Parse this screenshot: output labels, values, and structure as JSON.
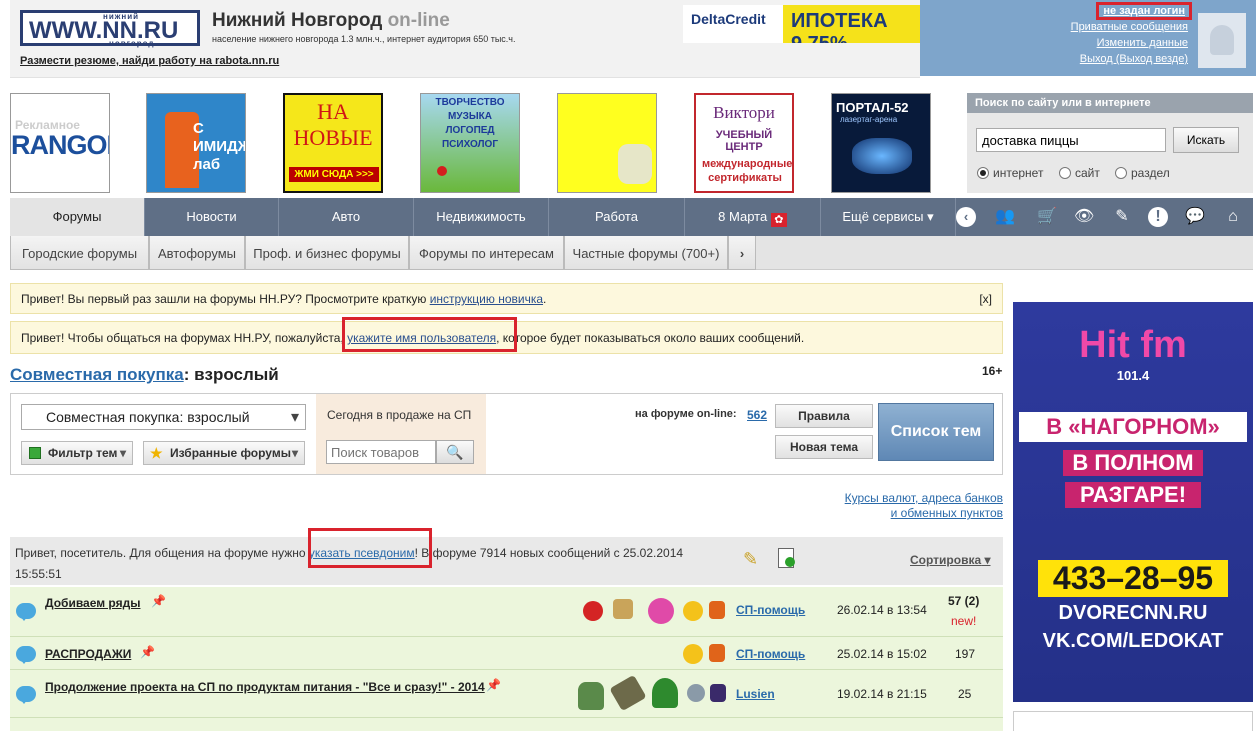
{
  "header": {
    "logo_top": "нижний",
    "logo_main": "WWW.NN.RU",
    "logo_bottom": "новгород",
    "title": "Нижний Новгород",
    "title_suffix": "on-line",
    "subtitle": "население нижнего новгорода 1.3 млн.ч., интернет аудитория 650 тыс.ч.",
    "resume_link": "Размести резюме, найди работу на rabota.nn.ru",
    "delta_logo": "DeltaCredit",
    "delta_text": "ИПОТЕКА 9,75%"
  },
  "user": {
    "login_status": "не задан логин",
    "links": [
      "Приватные сообщения",
      "Изменить данные",
      "Выход (Выход везде)"
    ]
  },
  "ads": {
    "rangon": "RANGON",
    "imidj": "С ИМИДЖ лаб",
    "novye": "НА НОВЫЕ",
    "novye_sub": "ЖМИ СЮДА >>>",
    "tvorch": [
      "ТВОРЧЕСТВО",
      "МУЗЫКА",
      "ЛОГОПЕД",
      "ПСИХОЛОГ"
    ],
    "viktori": [
      "Виктори",
      "УЧЕБНЫЙ ЦЕНТР",
      "международные сертификаты"
    ],
    "portal": "ПОРТАЛ-52",
    "portal_sub": "лазертаг-арена"
  },
  "search": {
    "title": "Поиск по сайту или в интернете",
    "value": "доставка пиццы",
    "button": "Искать",
    "options": [
      "интернет",
      "сайт",
      "раздел"
    ],
    "selected": "интернет"
  },
  "main_nav": {
    "items": [
      "Форумы",
      "Новости",
      "Авто",
      "Недвижимость",
      "Работа",
      "8 Марта",
      "Ещё сервисы"
    ],
    "active": "Форумы"
  },
  "sub_nav": {
    "items": [
      "Городские форумы",
      "Автофорумы",
      "Проф. и бизнес форумы",
      "Форумы по интересам",
      "Частные форумы (700+)"
    ]
  },
  "notices": {
    "first_visit": "Привет! Вы первый раз зашли на форумы НН.РУ? Просмотрите краткую",
    "first_visit_link": "инструкцию новичка",
    "first_visit_end": ".",
    "close": "[x]",
    "name_prefix": "Привет! Чтобы общаться на форумах НН.РУ, пожалуйста,",
    "name_link": "укажите имя пользователя",
    "name_suffix": ", которое будет показываться около ваших сообщений."
  },
  "section": {
    "link": "Совместная покупка",
    "rest": ": взрослый",
    "age": "16+"
  },
  "panel": {
    "forum_select": "Совместная покупка: взрослый",
    "filter_btn": "Фильтр тем",
    "fav_btn": "Избранные форумы",
    "today_label": "Сегодня в продаже на СП",
    "goods_placeholder": "Поиск товаров",
    "online_label": "на форуме on-line:",
    "online_count": "562",
    "rules_btn": "Правила",
    "new_topic_btn": "Новая тема",
    "topics_btn": "Список тем"
  },
  "rates": [
    "Курсы валют, адреса банков",
    "и обменных пунктов"
  ],
  "greeting": {
    "prefix": "Привет, посетитель. Для общения на форуме нужно",
    "link": "указать псевдоним",
    "suffix": "! В форуме 7914 новых сообщений с 25.02.2014",
    "time": "15:55:51",
    "sort": "Сортировка"
  },
  "topics": [
    {
      "title": "Добиваем ряды",
      "author": "СП-помощь",
      "date": "26.02.14 в 13:54",
      "count": "57 (2)",
      "new": "new!"
    },
    {
      "title": "РАСПРОДАЖИ",
      "author": "СП-помощь",
      "date": "25.02.14 в 15:02",
      "count": "197",
      "new": ""
    },
    {
      "title": "Продолжение проекта на СП по продуктам питания - \"Все и сразу!\" - 2014",
      "author": "Lusien",
      "date": "19.02.14 в 21:15",
      "count": "25",
      "new": ""
    }
  ],
  "right_ad": {
    "brand": "Hit fm",
    "freq": "101.4",
    "line1": "В «НАГОРНОМ»",
    "line2": "В ПОЛНОМ",
    "line3": "РАЗГАРЕ!",
    "phone": "433–28–95",
    "site1": "DVORECNN.RU",
    "site2": "VK.COM/LEDOKAT"
  },
  "colors": {
    "nav_bg": "#5f6f86",
    "user_bg": "#7ea5cb",
    "highlight": "#d9232d",
    "row_bg": "#ecf6dc"
  }
}
